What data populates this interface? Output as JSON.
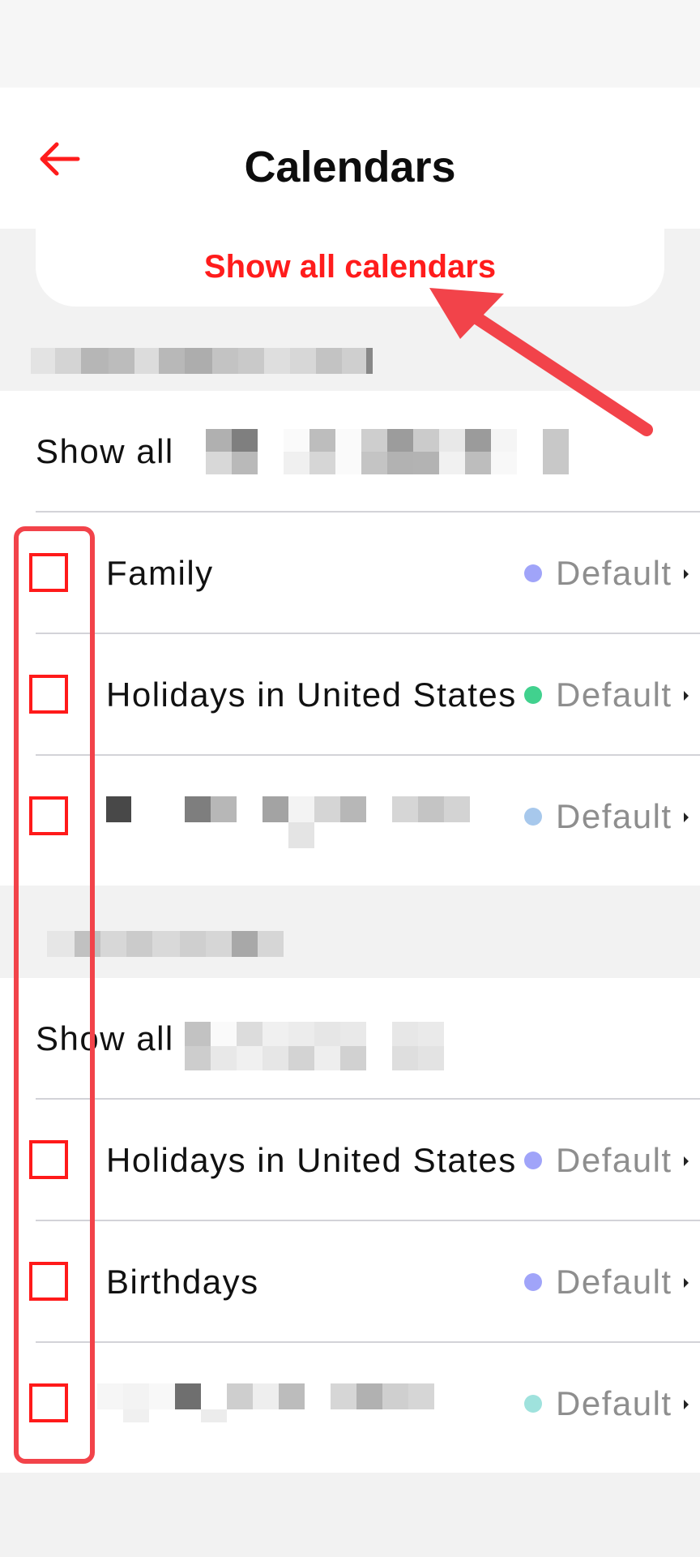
{
  "header": {
    "title": "Calendars"
  },
  "show_all_calendars_label": "Show all calendars",
  "sections": [
    {
      "show_all_label": "Show all",
      "items": [
        {
          "label": "Family",
          "dot_color": "#a0a4f9",
          "value": "Default"
        },
        {
          "label": "Holidays in United States",
          "dot_color": "#41d18e",
          "value": "Default"
        },
        {
          "label": "",
          "dot_color": "#a7c8ec",
          "value": "Default"
        }
      ]
    },
    {
      "show_all_label": "Show all",
      "items": [
        {
          "label": "Holidays in United States",
          "dot_color": "#a0a4f9",
          "value": "Default"
        },
        {
          "label": "Birthdays",
          "dot_color": "#a0a4f9",
          "value": "Default"
        },
        {
          "label": "",
          "dot_color": "#9fe2dd",
          "value": "Default"
        }
      ]
    }
  ],
  "colors": {
    "accent": "#ff1c1c",
    "annotation": "#f2434a"
  }
}
